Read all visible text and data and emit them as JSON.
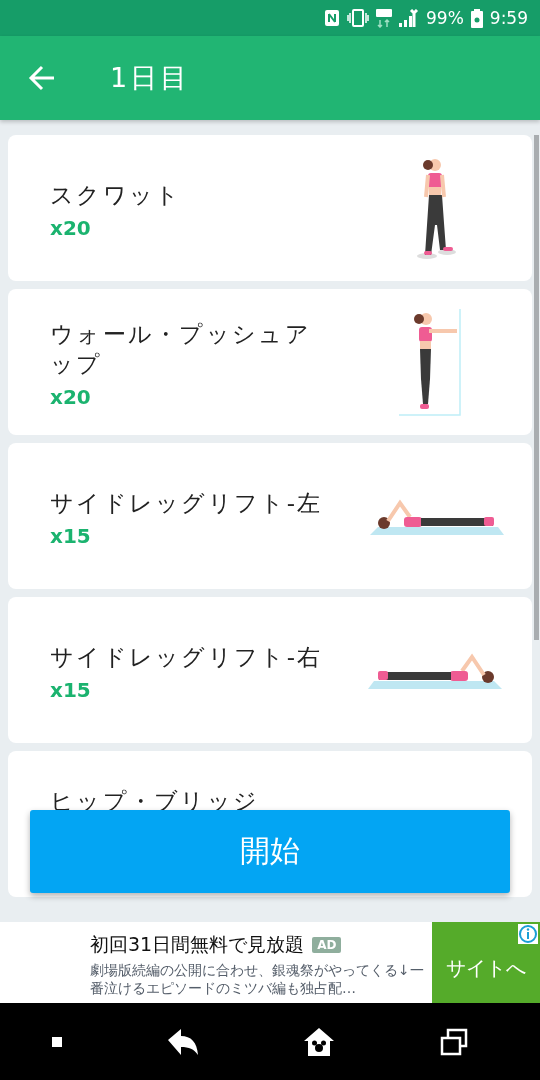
{
  "status_bar": {
    "battery": "99%",
    "time": "9:59"
  },
  "app_bar": {
    "title": "1日目"
  },
  "exercises": [
    {
      "name": "スクワット",
      "reps": "x20",
      "kind": "standing"
    },
    {
      "name": "ウォール・プッシュアップ",
      "reps": "x20",
      "kind": "wall"
    },
    {
      "name": "サイドレッグリフト-左",
      "reps": "x15",
      "kind": "lying_left"
    },
    {
      "name": "サイドレッグリフト-右",
      "reps": "x15",
      "kind": "lying_right"
    },
    {
      "name": "ヒップ・ブリッジ",
      "kind": "hidden"
    }
  ],
  "start_button": {
    "label": "開始"
  },
  "ad": {
    "title": "初回31日間無料で見放題",
    "badge": "AD",
    "body": "劇場版続編の公開に合わせ、銀魂祭がやってくる↓一番泣けるエピソードのミツバ編も独占配…",
    "cta": "サイトへ"
  }
}
